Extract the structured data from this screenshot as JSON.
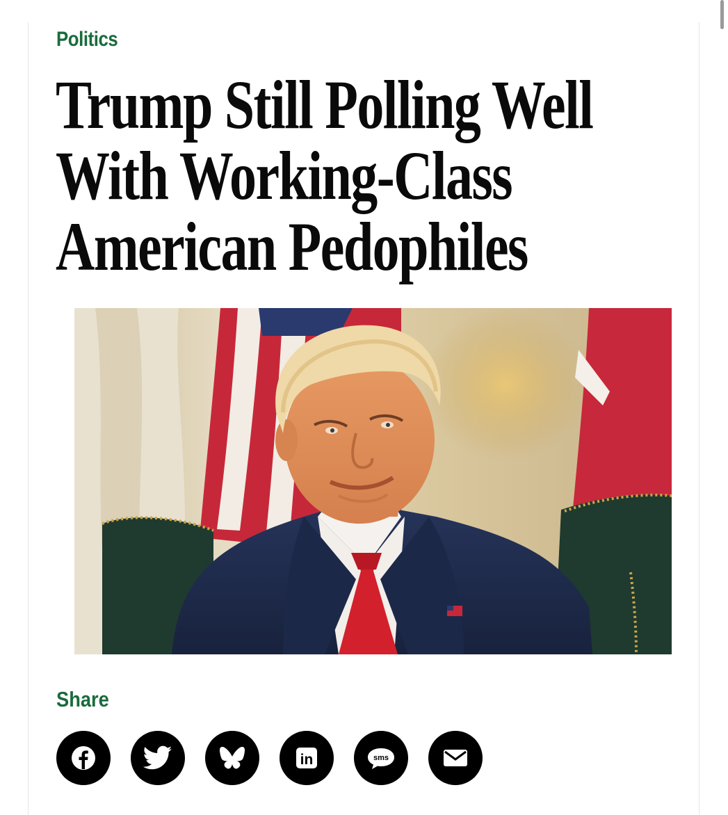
{
  "article": {
    "category": "Politics",
    "headline_lines": [
      "Trump Still Polling Well",
      "With Working-Class",
      "American Pedophiles"
    ],
    "hero_image": {
      "subject": "photo of Donald Trump in a navy suit and red tie seated in a green armchair in front of flags"
    }
  },
  "share": {
    "label": "Share",
    "buttons": [
      {
        "icon": "facebook-icon"
      },
      {
        "icon": "twitter-icon"
      },
      {
        "icon": "bluesky-icon"
      },
      {
        "icon": "linkedin-icon",
        "glyph": "in"
      },
      {
        "icon": "sms-icon",
        "glyph": "sms"
      },
      {
        "icon": "email-icon"
      }
    ]
  },
  "colors": {
    "accent_green": "#1a6b3c",
    "headline": "#0a0a0a",
    "share_button_bg": "#000000"
  }
}
